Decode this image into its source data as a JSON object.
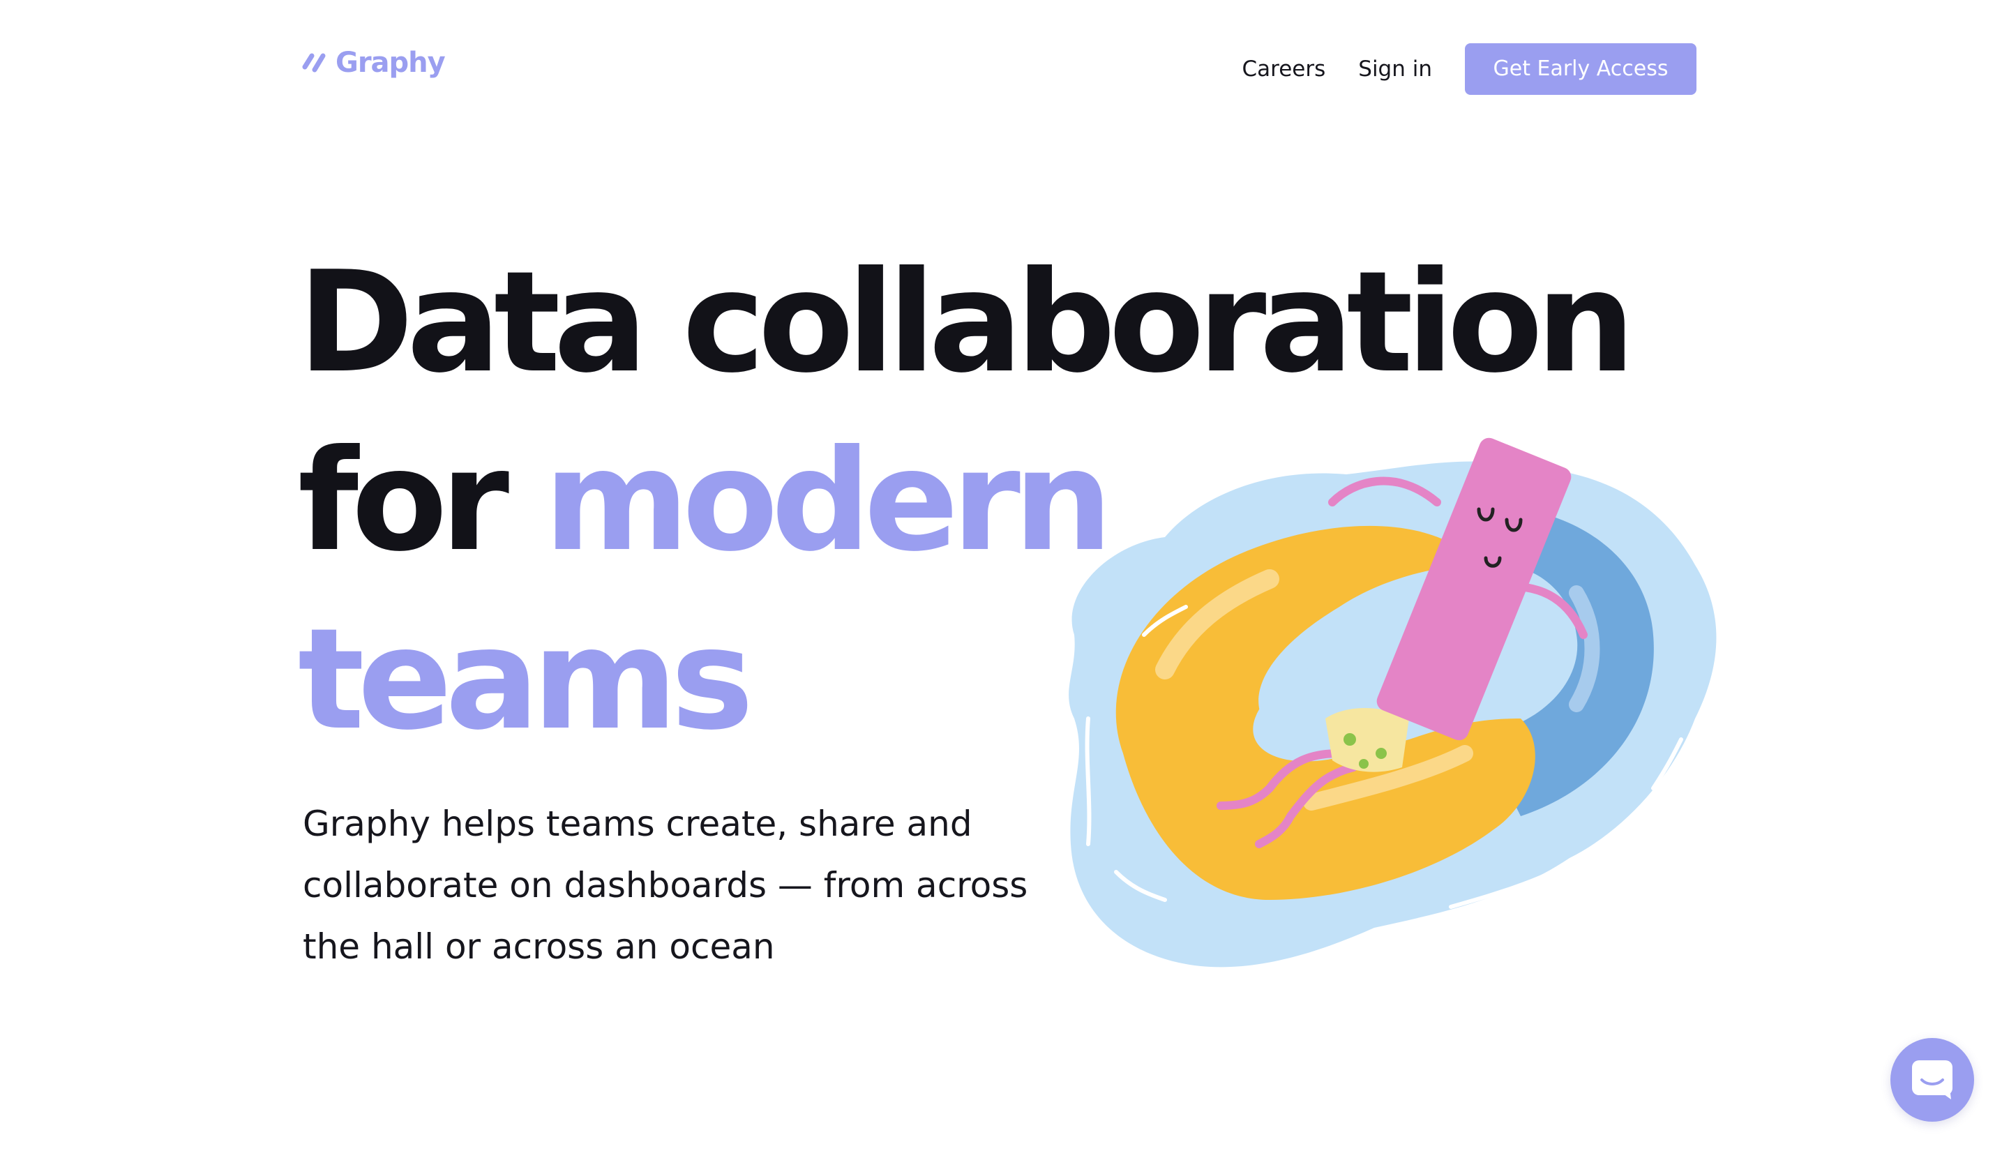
{
  "brand": {
    "name": "Graphy",
    "accent_color": "#9a9ef0",
    "text_color": "#121218"
  },
  "nav": {
    "links": [
      {
        "label": "Careers"
      },
      {
        "label": "Sign in"
      }
    ],
    "cta_label": "Get Early Access"
  },
  "hero": {
    "headline_line1": "Data collaboration",
    "headline_line2_plain": "for ",
    "headline_line2_accent": "modern",
    "headline_line3_accent": "teams",
    "subtext": "Graphy helps teams create, share and collaborate on dashboards — from across the hall or across an ocean"
  },
  "illustration": {
    "description_icon": "relaxing-bar-character-on-swim-ring-illustration",
    "colors": {
      "water": "#c2e1f8",
      "ring_yellow": "#f8bd38",
      "ring_blue": "#6fa8dc",
      "character_pink": "#e484c6"
    }
  },
  "chat": {
    "icon": "chat-bubble-icon"
  }
}
